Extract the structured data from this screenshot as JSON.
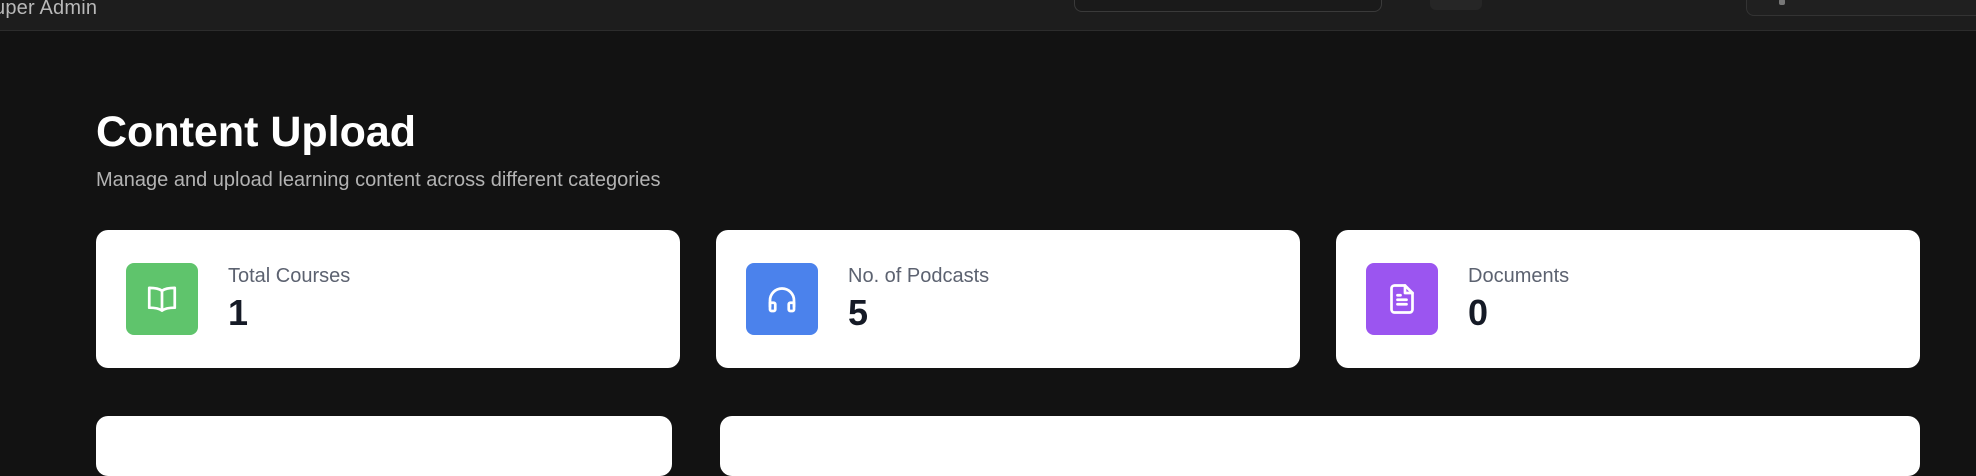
{
  "header": {
    "role_label": "uper Admin"
  },
  "page": {
    "title": "Content Upload",
    "subtitle": "Manage and upload learning content across different categories"
  },
  "stats": [
    {
      "label": "Total Courses",
      "value": "1",
      "icon": "book-open-icon",
      "color": "#5fc46c"
    },
    {
      "label": "No. of Podcasts",
      "value": "5",
      "icon": "headphones-icon",
      "color": "#4b82ec"
    },
    {
      "label": "Documents",
      "value": "0",
      "icon": "document-icon",
      "color": "#9b55f0"
    }
  ]
}
